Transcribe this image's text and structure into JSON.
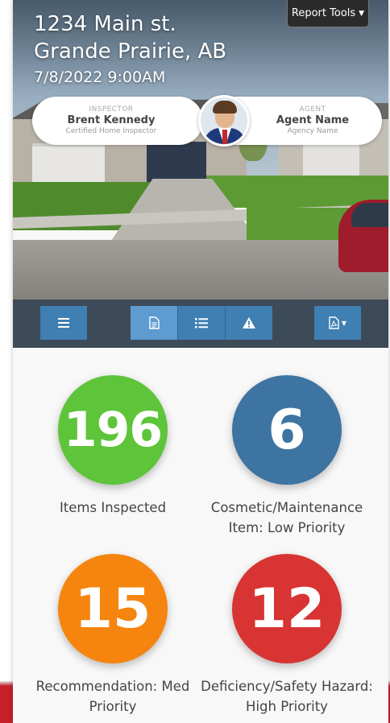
{
  "header": {
    "address_line1": "1234 Main st.",
    "address_line2": "Grande Prairie, AB",
    "datetime": "7/8/2022 9:00AM",
    "report_tools_label": "Report Tools"
  },
  "inspector": {
    "role": "INSPECTOR",
    "name": "Brent Kennedy",
    "title": "Certified Home Inspector"
  },
  "agent": {
    "role": "AGENT",
    "name": "Agent Name",
    "agency": "Agency Name"
  },
  "toolbar": {
    "icons": [
      "menu-icon",
      "document-icon",
      "list-icon",
      "warning-icon",
      "pdf-icon"
    ]
  },
  "stats": [
    {
      "value": "196",
      "label_line1": "Items Inspected",
      "label_line2": "",
      "color": "#5ec43a"
    },
    {
      "value": "6",
      "label_line1": "Cosmetic/Maintenance",
      "label_line2": "Item: Low Priority",
      "color": "#3d74a1"
    },
    {
      "value": "15",
      "label_line1": "Recommendation: Med",
      "label_line2": "Priority",
      "color": "#f5850f"
    },
    {
      "value": "12",
      "label_line1": "Deficiency/Safety Hazard:",
      "label_line2": "High Priority",
      "color": "#d83433"
    }
  ],
  "colors": {
    "toolbar_bg": "#3d4a57",
    "button_blue": "#3f7fb2",
    "button_active": "#5d9bd0",
    "footer_red": "#c6202a"
  }
}
